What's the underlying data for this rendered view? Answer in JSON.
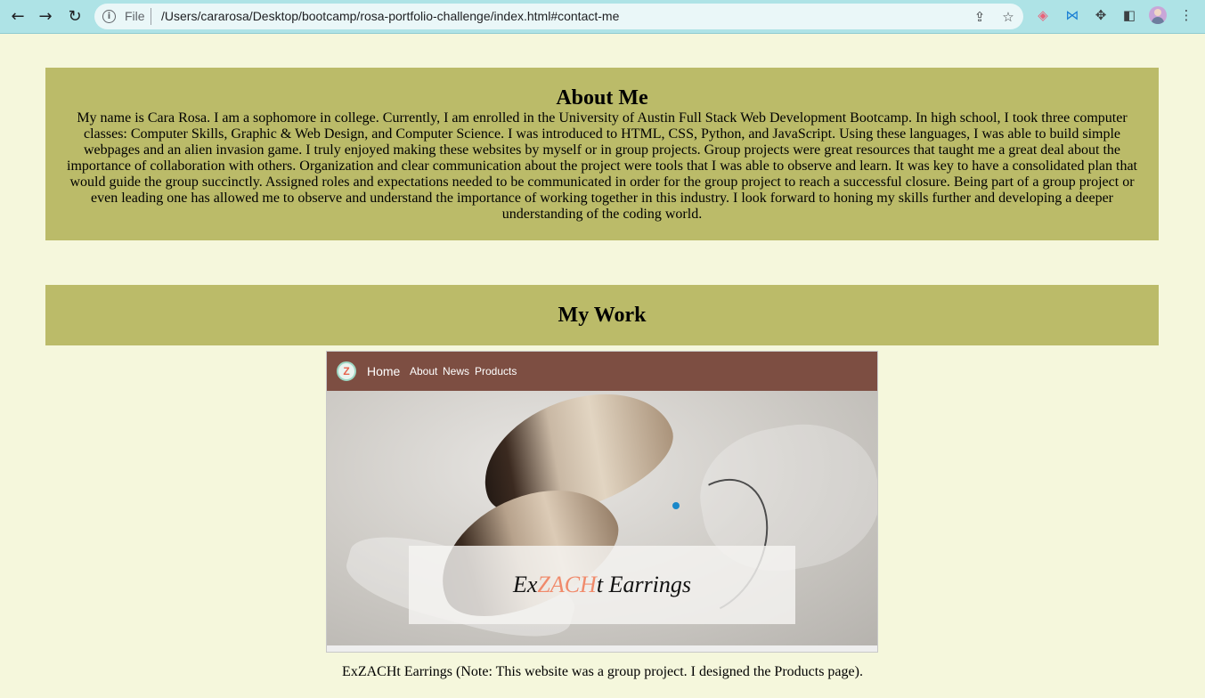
{
  "browser": {
    "back_icon": "arrow-left-icon",
    "forward_icon": "arrow-right-icon",
    "reload_icon": "reload-icon",
    "scheme_label": "File",
    "url": "/Users/cararosa/Desktop/bootcamp/rosa-portfolio-challenge/index.html#contact-me",
    "toolbar_color": "#aee3e6"
  },
  "about": {
    "title": "About Me",
    "body": "My name is Cara Rosa. I am a sophomore in college. Currently, I am enrolled in the University of Austin Full Stack Web Development Bootcamp. In high school, I took three computer classes: Computer Skills, Graphic & Web Design, and Computer Science. I was introduced to HTML, CSS, Python, and JavaScript. Using these languages, I was able to build simple webpages and an alien invasion game. I truly enjoyed making these websites by myself or in group projects. Group projects were great resources that taught me a great deal about the importance of collaboration with others. Organization and clear communication about the project were tools that I was able to observe and learn. It was key to have a consolidated plan that would guide the group succinctly. Assigned roles and expectations needed to be communicated in order for the group project to reach a successful closure. Being part of a group project or even leading one has allowed me to observe and understand the importance of working together in this industry. I look forward to honing my skills further and developing a deeper understanding of the coding world."
  },
  "work": {
    "title": "My Work",
    "project": {
      "logo_letter": "Z",
      "nav": {
        "home": "Home",
        "about": "About",
        "news": "News",
        "products": "Products"
      },
      "hero_title_pre": "Ex",
      "hero_title_accent": "ZACH",
      "hero_title_post": "t Earrings",
      "caption": "ExZACHt Earrings (Note: This website was a group project. I designed the Products page)."
    }
  },
  "colors": {
    "page_bg": "#f5f7dc",
    "section_bg": "#bbbb69",
    "project_nav_bg": "#7d4e42",
    "accent": "#f08a6b"
  }
}
